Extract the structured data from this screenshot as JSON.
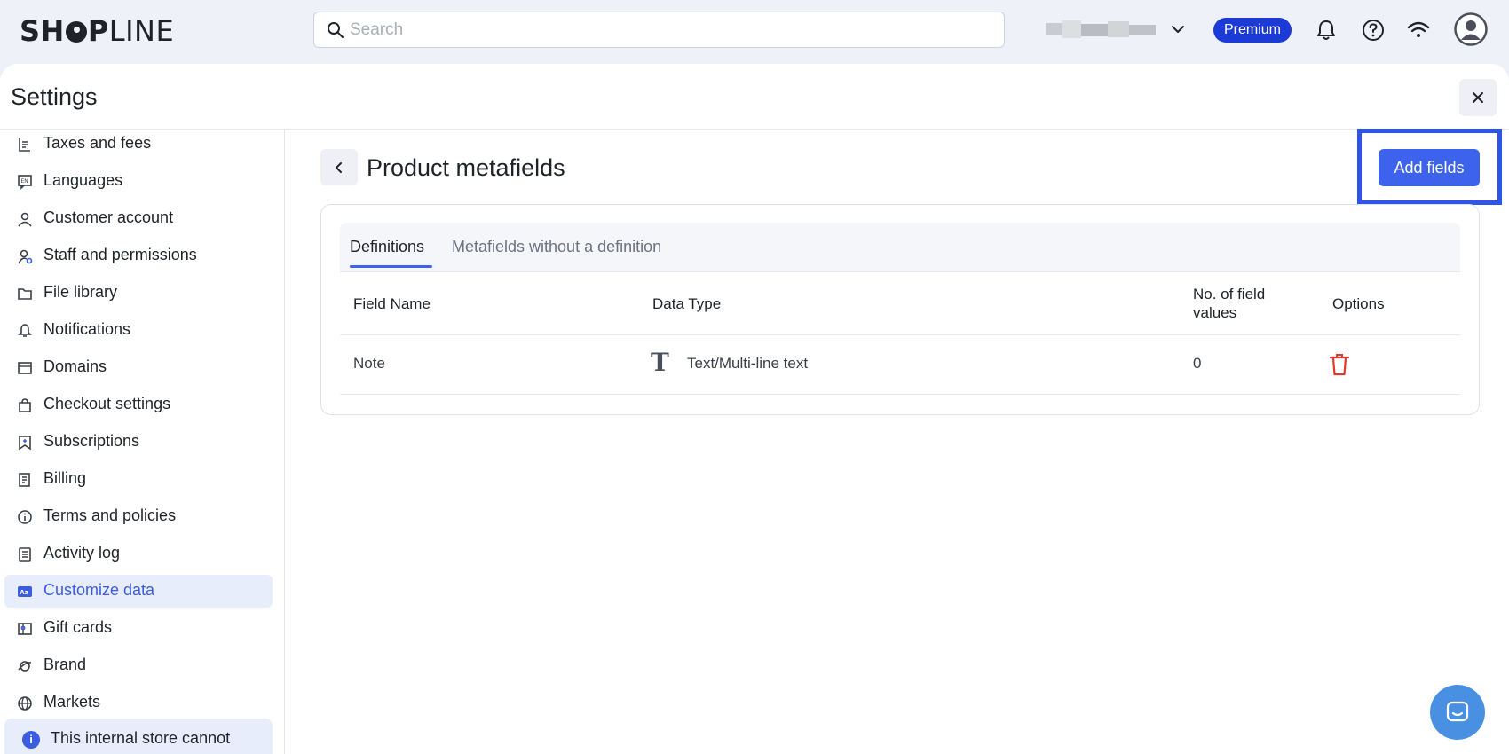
{
  "topbar": {
    "logo_bold": "SH",
    "logo_bold2": "P",
    "logo_light": "LINE",
    "search_placeholder": "Search",
    "premium_label": "Premium"
  },
  "settings": {
    "title": "Settings"
  },
  "sidebar": {
    "items": [
      {
        "label": "Taxes and fees",
        "icon": "receipt-icon"
      },
      {
        "label": "Languages",
        "icon": "language-icon"
      },
      {
        "label": "Customer account",
        "icon": "user-icon"
      },
      {
        "label": "Staff and permissions",
        "icon": "staff-icon"
      },
      {
        "label": "File library",
        "icon": "folder-icon"
      },
      {
        "label": "Notifications",
        "icon": "bell-icon"
      },
      {
        "label": "Domains",
        "icon": "domain-icon"
      },
      {
        "label": "Checkout settings",
        "icon": "bag-icon"
      },
      {
        "label": "Subscriptions",
        "icon": "subscription-icon"
      },
      {
        "label": "Billing",
        "icon": "billing-icon"
      },
      {
        "label": "Terms and policies",
        "icon": "info-icon"
      },
      {
        "label": "Activity log",
        "icon": "log-icon"
      },
      {
        "label": "Customize data",
        "icon": "customize-data-icon"
      },
      {
        "label": "Gift cards",
        "icon": "gift-card-icon"
      },
      {
        "label": "Brand",
        "icon": "brand-icon"
      },
      {
        "label": "Markets",
        "icon": "globe-icon"
      }
    ],
    "notice": "This internal store cannot"
  },
  "main": {
    "title": "Product metafields",
    "add_button": "Add fields",
    "tabs": [
      "Definitions",
      "Metafields without a definition"
    ],
    "columns": {
      "field_name": "Field Name",
      "data_type": "Data Type",
      "count_line1": "No. of field",
      "count_line2": "values",
      "options": "Options"
    },
    "rows": [
      {
        "field_name": "Note",
        "data_type": "Text/Multi-line text",
        "type_glyph": "T",
        "count": "0"
      }
    ]
  },
  "colors": {
    "accent": "#3d63ec",
    "premium": "#1c3bd6",
    "delete": "#e03a2f",
    "active_bg": "#e8edfb"
  }
}
